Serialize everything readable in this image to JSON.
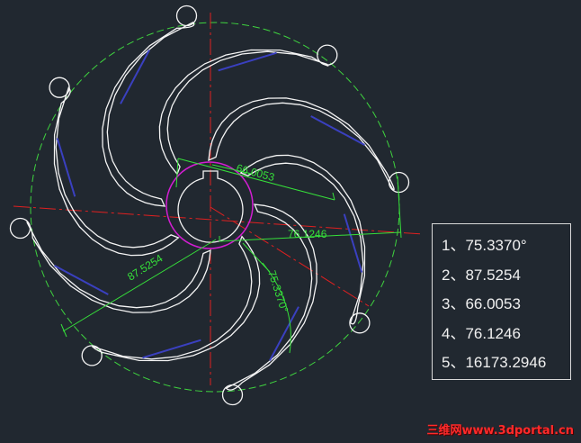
{
  "colors": {
    "background": "#212830",
    "outline": "#f4f4f4",
    "centerline": "#e02020",
    "construction_circle": "#3fd43f",
    "dimension": "#36e03a",
    "hub_circle": "#d21ed2",
    "hidden_edge": "#3a40c0",
    "watermark": "#ff2a2a"
  },
  "dimensions": {
    "d1": "75.3370°",
    "d2": "87.5254",
    "d3": "66.0053",
    "d4": "76.1246"
  },
  "results": [
    {
      "number": "1、",
      "value": "75.3370°"
    },
    {
      "number": "2、",
      "value": "87.5254"
    },
    {
      "number": "3、",
      "value": "66.0053"
    },
    {
      "number": "4、",
      "value": "76.1246"
    },
    {
      "number": "5、",
      "value": "16173.2946"
    }
  ],
  "watermark": "三维网www.3dportal.cn"
}
